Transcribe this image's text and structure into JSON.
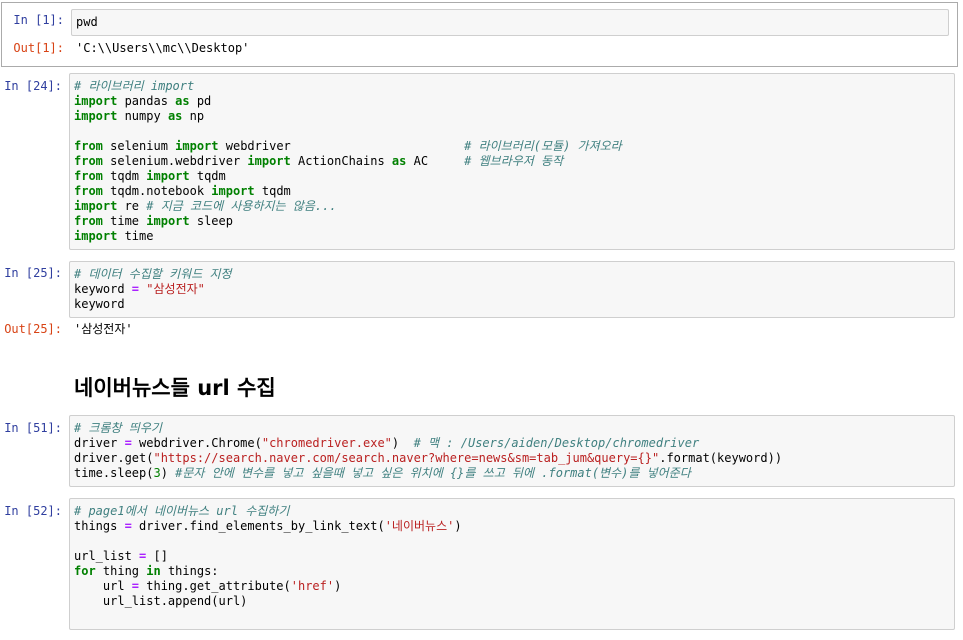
{
  "cells": [
    {
      "in_prompt": "In [1]:",
      "code": [
        "pwd"
      ],
      "out_prompt": "Out[1]:",
      "output": "'C:\\\\Users\\\\mc\\\\Desktop'"
    },
    {
      "in_prompt": "In [24]:",
      "code": [
        "# 라이브러리 import",
        "import pandas as pd",
        "import numpy as np",
        "",
        "from selenium import webdriver                        # 라이브러리(모듈) 가져오라",
        "from selenium.webdriver import ActionChains as AC     # 웹브라우저 동작",
        "from tqdm import tqdm",
        "from tqdm.notebook import tqdm",
        "import re # 지금 코드에 사용하지는 않음...",
        "from time import sleep",
        "import time"
      ]
    },
    {
      "in_prompt": "In [25]:",
      "code": [
        "# 데이터 수집할 키워드 지정",
        "keyword = \"삼성전자\"",
        "keyword"
      ],
      "out_prompt": "Out[25]:",
      "output": "'삼성전자'"
    },
    {
      "markdown_heading": "네이버뉴스들 url 수집"
    },
    {
      "in_prompt": "In [51]:",
      "code": [
        "# 크롬창 띄우기",
        "driver = webdriver.Chrome(\"chromedriver.exe\")  # 맥 : /Users/aiden/Desktop/chromedriver",
        "driver.get(\"https://search.naver.com/search.naver?where=news&sm=tab_jum&query={}\".format(keyword))",
        "time.sleep(3) #문자 안에 변수를 넣고 싶을때 넣고 싶은 위치에 {}를 쓰고 뒤에 .format(변수)를 넣어준다"
      ]
    },
    {
      "in_prompt": "In [52]:",
      "code": [
        "# page1에서 네이버뉴스 url 수집하기",
        "things = driver.find_elements_by_link_text('네이버뉴스')",
        "",
        "url_list = []",
        "for thing in things:",
        "    url = thing.get_attribute('href')",
        "    url_list.append(url)"
      ]
    }
  ]
}
